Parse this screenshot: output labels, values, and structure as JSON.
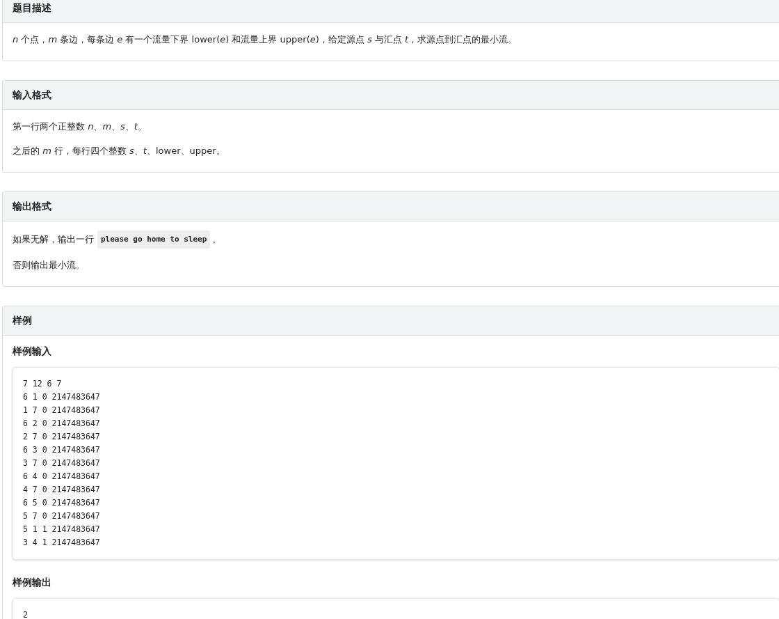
{
  "sections": [
    {
      "title": "题目描述",
      "kind": "text",
      "paragraphs": [
        [
          {
            "kind": "text",
            "text": "*n* 个点，*m* 条边，每条边 *e* 有一个流量下界 lower(*e*) 和流量上界 upper(*e*)，给定源点 *s* 与汇点 *t*，求源点到汇点的最小流。"
          }
        ]
      ]
    },
    {
      "title": "输入格式",
      "kind": "text",
      "paragraphs": [
        [
          {
            "kind": "text",
            "text": "第一行两个正整数 *n*、*m*、*s*、*t*。"
          }
        ],
        [
          {
            "kind": "text",
            "text": "之后的 *m* 行，每行四个整数 *s*、*t*、lower、upper。"
          }
        ]
      ]
    },
    {
      "title": "输出格式",
      "kind": "text",
      "paragraphs": [
        [
          {
            "kind": "text",
            "text": "如果无解，输出一行"
          },
          {
            "kind": "code",
            "text": "please go home to sleep"
          },
          {
            "kind": "text",
            "text": "。"
          }
        ],
        [
          {
            "kind": "text",
            "text": "否则输出最小流。"
          }
        ]
      ]
    },
    {
      "title": "样例",
      "kind": "samples",
      "samples": [
        {
          "label": "样例输入",
          "lines": [
            "7 12 6 7",
            "6 1 0 2147483647",
            "1 7 0 2147483647",
            "6 2 0 2147483647",
            "2 7 0 2147483647",
            "6 3 0 2147483647",
            "3 7 0 2147483647",
            "6 4 0 2147483647",
            "4 7 0 2147483647",
            "6 5 0 2147483647",
            "5 7 0 2147483647",
            "5 1 1 2147483647",
            "3 4 1 2147483647"
          ]
        },
        {
          "label": "样例输出",
          "lines": [
            "2"
          ]
        }
      ]
    }
  ]
}
